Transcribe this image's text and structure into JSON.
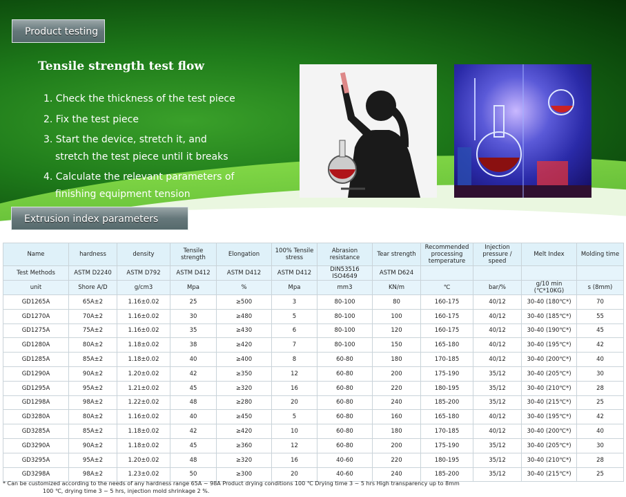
{
  "banner": {
    "product_testing_label": "Product testing",
    "extrusion_label": "Extrusion index parameters",
    "title": "Tensile strength test flow",
    "steps": [
      "1. Check the thickness of the test piece",
      "2. Fix the test piece",
      "3. Start the device, stretch it, and stretch the test piece until it breaks",
      "4. Calculate the relevant   parameters  of finishing equipment tension"
    ],
    "photos": [
      "lab-scientist-photo",
      "lab-glassware-photo"
    ]
  },
  "table": {
    "headers": [
      "Name",
      "hardness",
      "density",
      "Tensile strength",
      "Elongation",
      "100% Tensile stress",
      "Abrasion resistance",
      "Tear strength",
      "Recommended processing temperature",
      "Injection pressure / speed",
      "Melt Index",
      "Molding time"
    ],
    "methods": [
      "Test Methods",
      "ASTM  D2240",
      "ASTM       D792",
      "ASTM D412",
      "ASTM    D412",
      "ASTM D412",
      "DIN53516 ISO4649",
      "ASTM D624",
      "",
      "",
      "",
      ""
    ],
    "units": [
      "unit",
      "Shore A/D",
      "g/cm3",
      "Mpa",
      "%",
      "Mpa",
      "mm3",
      "KN/m",
      "℃",
      "bar/%",
      "g/10 min (℃*10KG)",
      "s (8mm)"
    ],
    "rows": [
      [
        "GD1265A",
        "65A±2",
        "1.16±0.02",
        "25",
        "≥500",
        "3",
        "80-100",
        "80",
        "160-175",
        "40/12",
        "30-40 (180℃*)",
        "70"
      ],
      [
        "GD1270A",
        "70A±2",
        "1.16±0.02",
        "30",
        "≥480",
        "5",
        "80-100",
        "100",
        "160-175",
        "40/12",
        "30-40 (185℃*)",
        "55"
      ],
      [
        "GD1275A",
        "75A±2",
        "1.16±0.02",
        "35",
        "≥430",
        "6",
        "80-100",
        "120",
        "160-175",
        "40/12",
        "30-40 (190℃*)",
        "45"
      ],
      [
        "GD1280A",
        "80A±2",
        "1.18±0.02",
        "38",
        "≥420",
        "7",
        "80-100",
        "150",
        "165-180",
        "40/12",
        "30-40 (195℃*)",
        "42"
      ],
      [
        "GD1285A",
        "85A±2",
        "1.18±0.02",
        "40",
        "≥400",
        "8",
        "60-80",
        "180",
        "170-185",
        "40/12",
        "30-40 (200℃*)",
        "40"
      ],
      [
        "GD1290A",
        "90A±2",
        "1.20±0.02",
        "42",
        "≥350",
        "12",
        "60-80",
        "200",
        "175-190",
        "35/12",
        "30-40 (205℃*)",
        "30"
      ],
      [
        "GD1295A",
        "95A±2",
        "1.21±0.02",
        "45",
        "≥320",
        "16",
        "60-80",
        "220",
        "180-195",
        "35/12",
        "30-40 (210℃*)",
        "28"
      ],
      [
        "GD1298A",
        "98A±2",
        "1.22±0.02",
        "48",
        "≥280",
        "20",
        "60-80",
        "240",
        "185-200",
        "35/12",
        "30-40 (215℃*)",
        "25"
      ],
      [
        "GD3280A",
        "80A±2",
        "1.16±0.02",
        "40",
        "≥450",
        "5",
        "60-80",
        "160",
        "165-180",
        "40/12",
        "30-40 (195℃*)",
        "42"
      ],
      [
        "GD3285A",
        "85A±2",
        "1.18±0.02",
        "42",
        "≥420",
        "10",
        "60-80",
        "180",
        "170-185",
        "40/12",
        "30-40 (200℃*)",
        "40"
      ],
      [
        "GD3290A",
        "90A±2",
        "1.18±0.02",
        "45",
        "≥360",
        "12",
        "60-80",
        "200",
        "175-190",
        "35/12",
        "30-40 (205℃*)",
        "30"
      ],
      [
        "GD3295A",
        "95A±2",
        "1.20±0.02",
        "48",
        "≥320",
        "16",
        "40-60",
        "220",
        "180-195",
        "35/12",
        "30-40 (210℃*)",
        "28"
      ],
      [
        "GD3298A",
        "98A±2",
        "1.23±0.02",
        "50",
        "≥300",
        "20",
        "40-60",
        "240",
        "185-200",
        "35/12",
        "30-40 (215℃*)",
        "25"
      ]
    ]
  },
  "note": {
    "line1": "* Can be customized according to the needs of any hardness range 65A ~ 98A Product drying conditions 100 ℃ Drying time 3 ~ 5 hrs High transparency up to 8mm",
    "line2": "100 ℃, drying time 3 ~ 5 hrs, injection mold shrinkage 2 %."
  }
}
